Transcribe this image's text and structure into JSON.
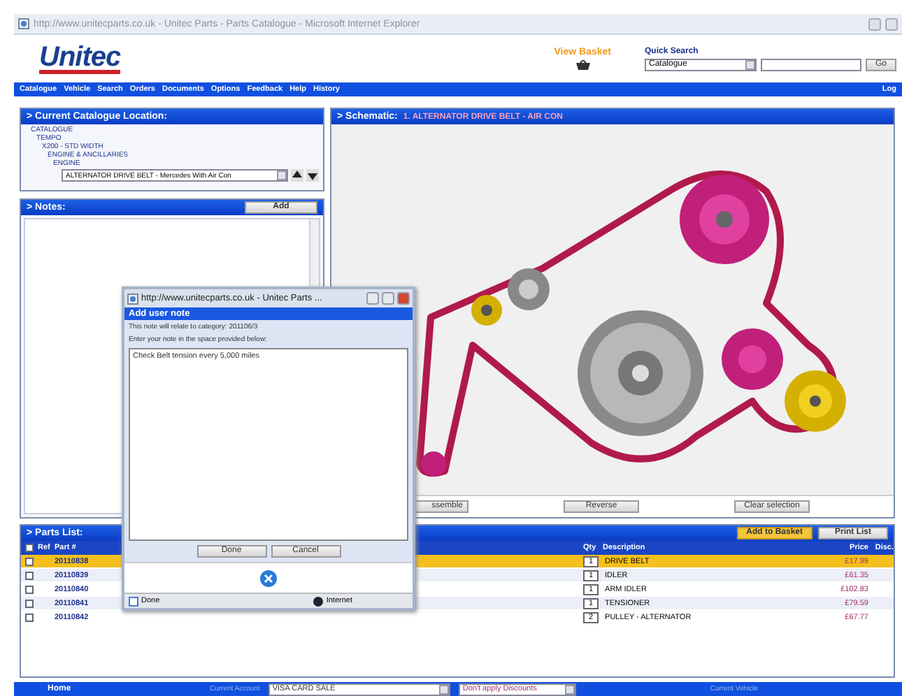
{
  "browser": {
    "title": "http://www.unitecparts.co.uk - Unitec Parts - Parts Catalogue - Microsoft Internet Explorer"
  },
  "header": {
    "logo": "Unitec",
    "basket_link": "View Basket",
    "search_label": "Quick Search",
    "search_scope": "Catalogue",
    "search_button": "Go"
  },
  "nav": {
    "items": [
      "Catalogue",
      "Vehicle",
      "Search",
      "Orders",
      "Documents",
      "Options",
      "Feedback",
      "Help",
      "History"
    ],
    "right": "Log"
  },
  "location": {
    "title": "> Current Catalogue Location:",
    "tree": [
      {
        "label": "CATALOGUE",
        "children": [
          {
            "label": "TEMPO",
            "children": [
              {
                "label": "X200 - STD WIDTH",
                "children": [
                  {
                    "label": "ENGINE & ANCILLARIES",
                    "children": [
                      {
                        "label": "ENGINE"
                      }
                    ]
                  }
                ]
              }
            ]
          }
        ]
      }
    ],
    "category": "ALTERNATOR DRIVE BELT - Mercedes With Air Con"
  },
  "notes": {
    "title": "> Notes:",
    "button": "Add"
  },
  "schematic": {
    "title": "> Schematic:",
    "subtitle": "1. ALTERNATOR DRIVE BELT - AIR CON",
    "buttons": [
      "ssemble",
      "Reverse",
      "Clear selection"
    ]
  },
  "parts_list": {
    "title": "> Parts List:",
    "select_all": false,
    "buttons": [
      "Add to Basket",
      "Print List"
    ],
    "columns": [
      "Ref",
      "Part #",
      "Qty",
      "Description",
      "Price",
      "Disc."
    ],
    "rows": [
      {
        "part": "20110838",
        "qty": "1",
        "description": "DRIVE BELT",
        "price": "£17.99",
        "selected": true,
        "checked": false
      },
      {
        "part": "20110839",
        "qty": "1",
        "description": "IDLER",
        "price": "£61.35",
        "selected": false,
        "checked": false
      },
      {
        "part": "20110840",
        "qty": "1",
        "description": "ARM IDLER",
        "price": "£102.83",
        "selected": false,
        "checked": false
      },
      {
        "part": "20110841",
        "qty": "1",
        "description": "TENSIONER",
        "price": "£79.59",
        "selected": false,
        "checked": false
      },
      {
        "part": "20110842",
        "qty": "2",
        "description": "PULLEY - ALTERNATOR",
        "price": "£67.77",
        "selected": false,
        "checked": false
      }
    ]
  },
  "footer": {
    "home": "Home",
    "account_label": "Current Account",
    "account": "VISA CARD SALE",
    "discount": "Don't apply Discounts",
    "vehicle_label": "Current Vehicle"
  },
  "popup": {
    "title": "http://www.unitecparts.co.uk - Unitec Parts ...",
    "heading": "Add user note",
    "info": "This note will relate to category: 201106/3",
    "prompt": "Enter your note in the space provided below:",
    "note": "Check Belt tension every 5,000 miles",
    "buttons": [
      "Done",
      "Cancel"
    ],
    "status": "Done",
    "zone": "Internet"
  }
}
